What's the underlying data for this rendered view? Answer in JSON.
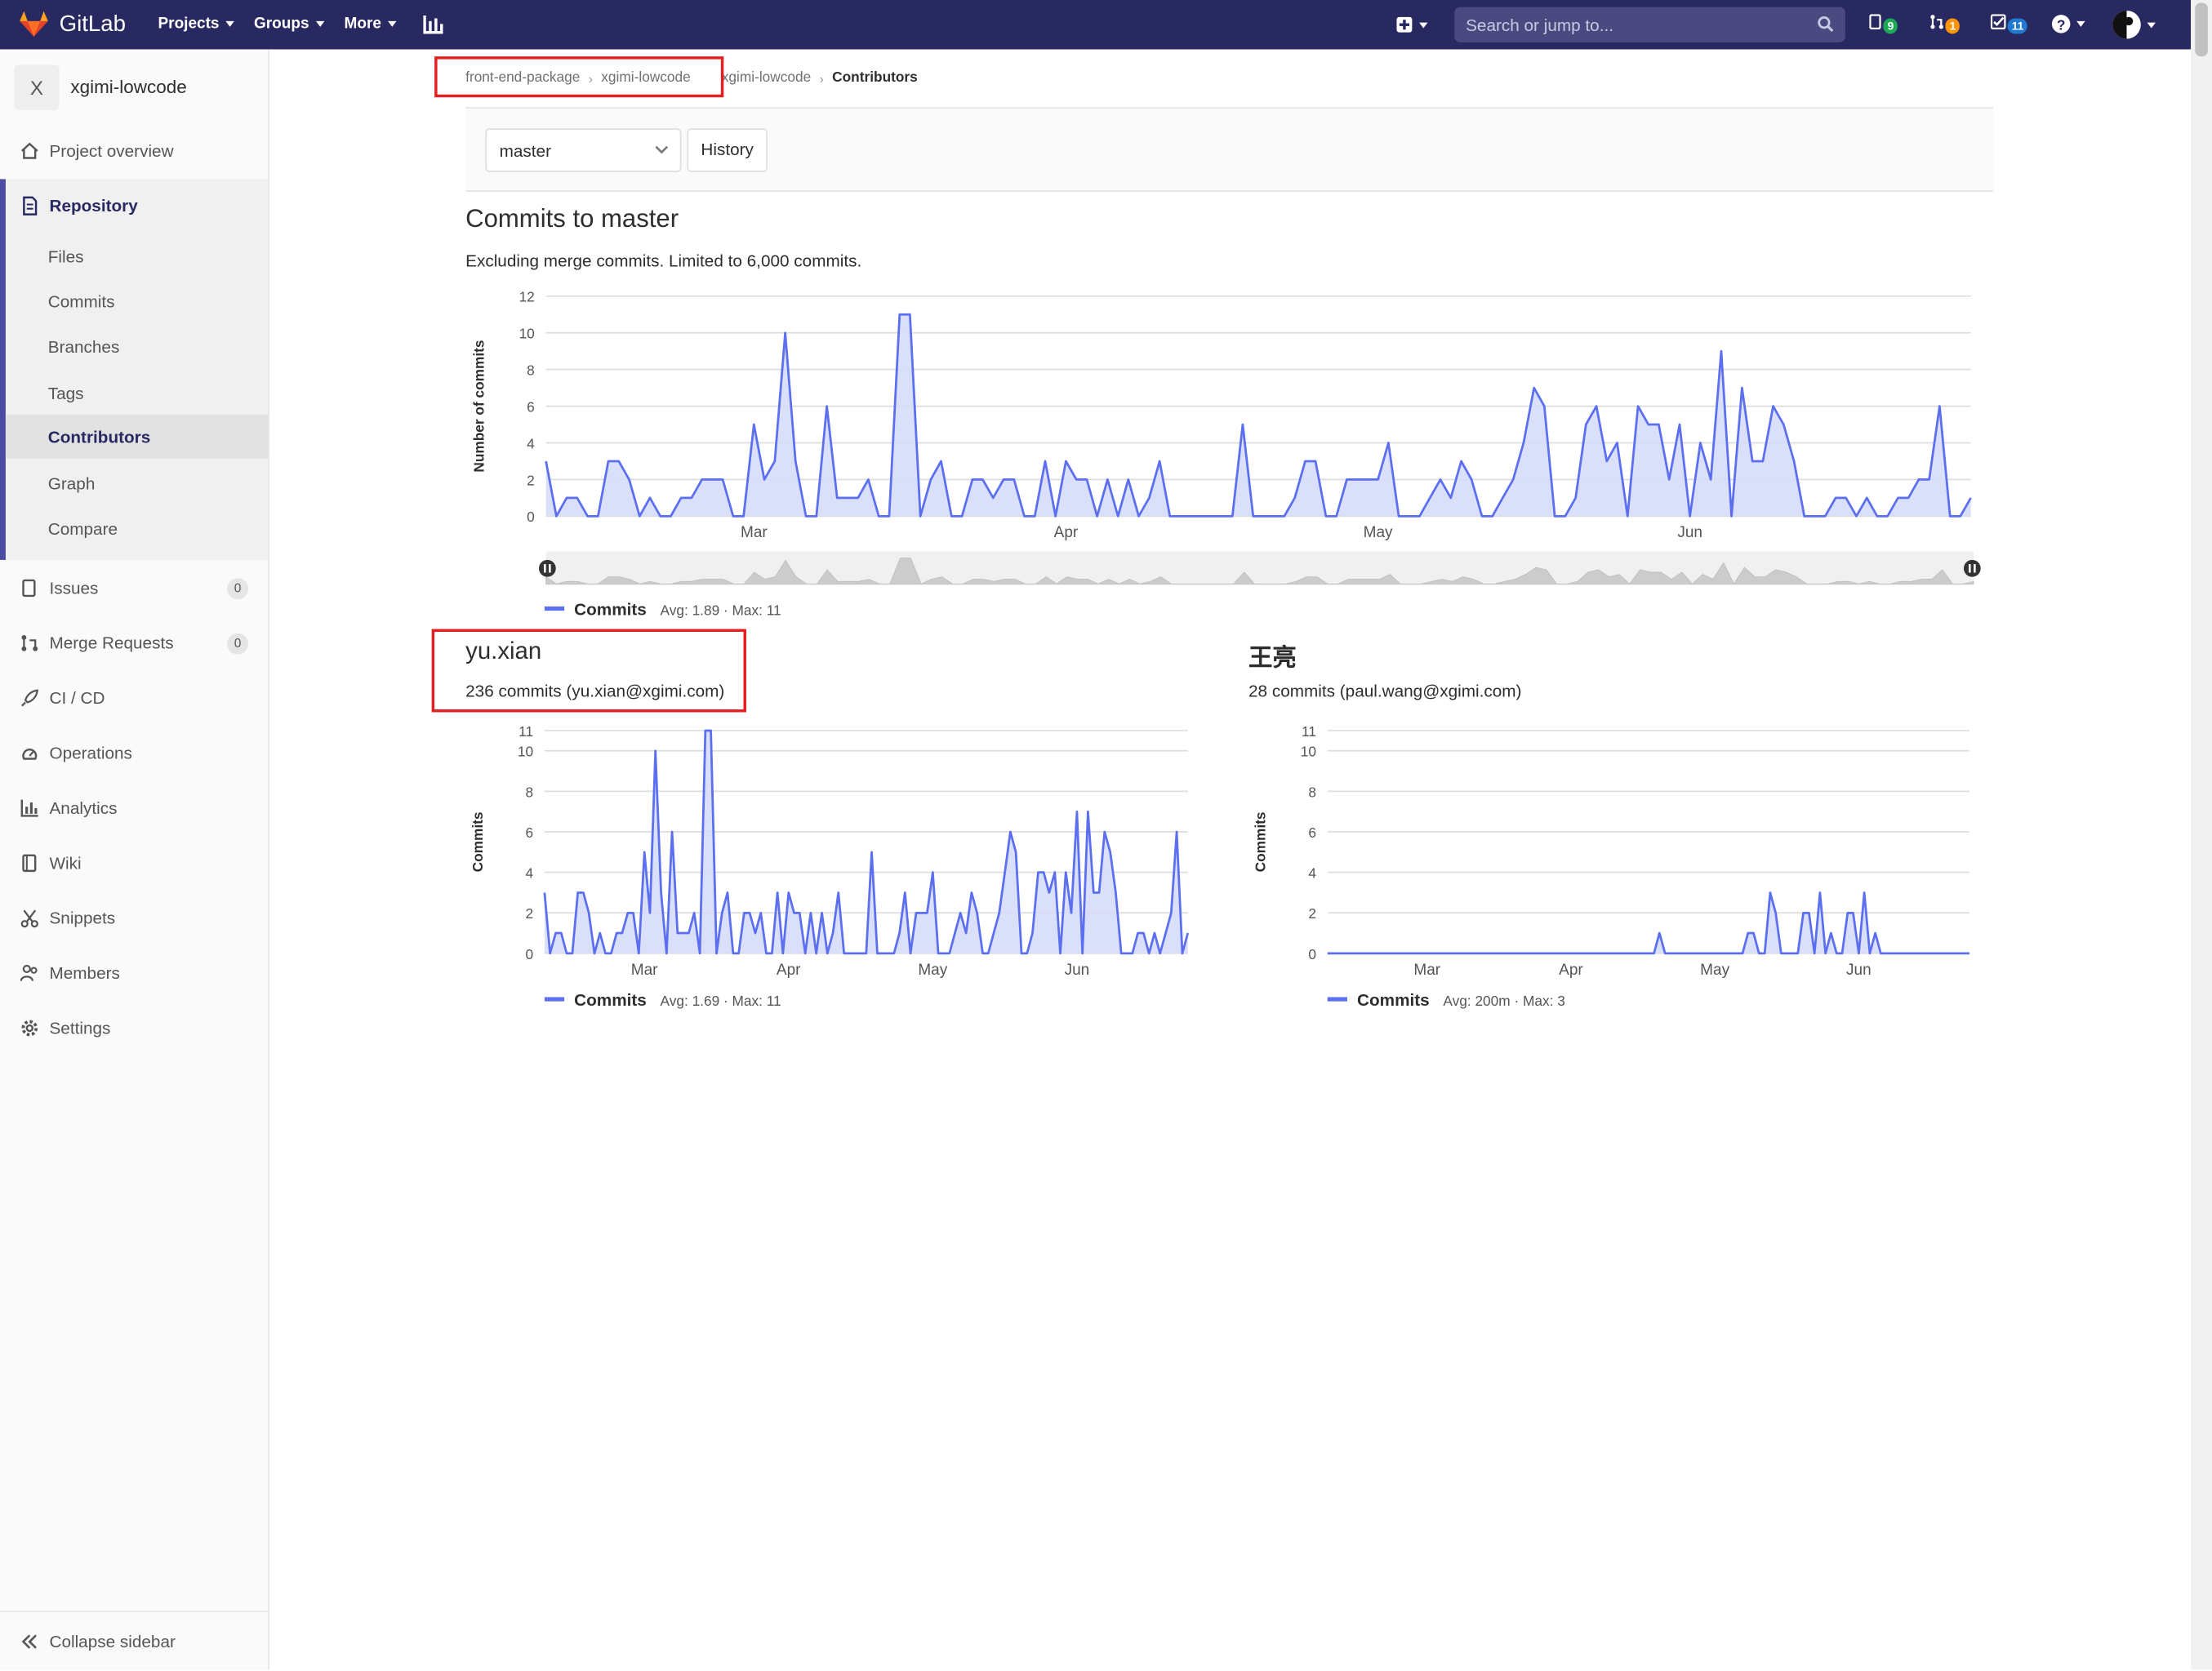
{
  "topbar": {
    "brand": "GitLab",
    "nav": [
      "Projects",
      "Groups",
      "More"
    ],
    "search_placeholder": "Search or jump to...",
    "counters": {
      "issues": "9",
      "merge_requests": "1",
      "todos": "11"
    },
    "colors": {
      "bg": "#292961",
      "issues_badge": "#1aaa55",
      "mr_badge": "#fc9403",
      "todo_badge": "#1f78d1"
    }
  },
  "sidebar": {
    "project_initial": "X",
    "project_name": "xgimi-lowcode",
    "overview": "Project overview",
    "repository": "Repository",
    "repo_items": [
      "Files",
      "Commits",
      "Branches",
      "Tags",
      "Contributors",
      "Graph",
      "Compare"
    ],
    "issues": {
      "label": "Issues",
      "count": "0"
    },
    "merge_requests": {
      "label": "Merge Requests",
      "count": "0"
    },
    "ci_cd": "CI / CD",
    "operations": "Operations",
    "analytics": "Analytics",
    "wiki": "Wiki",
    "snippets": "Snippets",
    "members": "Members",
    "settings": "Settings",
    "collapse": "Collapse sidebar"
  },
  "breadcrumb": [
    "front-end-package",
    "xgimi-lowcode",
    "xgimi-lowcode",
    "Contributors"
  ],
  "branch": {
    "selected": "master",
    "history_label": "History"
  },
  "main": {
    "title": "Commits to master",
    "subtitle": "Excluding merge commits. Limited to 6,000 commits."
  },
  "contributors": [
    {
      "name": "yu.xian",
      "commits_text": "236 commits (yu.xian@xgimi.com)"
    },
    {
      "name": "王亮",
      "commits_text": "28 commits (paul.wang@xgimi.com)"
    }
  ],
  "chart_data": [
    {
      "type": "area",
      "ylabel": "Number of commits",
      "ylim": [
        0,
        12
      ],
      "y_ticks": [
        0,
        2,
        4,
        6,
        8,
        10,
        12
      ],
      "x_tick_labels": [
        "Mar",
        "Apr",
        "May",
        "Jun"
      ],
      "x_tick_index": [
        20,
        50,
        80,
        110
      ],
      "legend": {
        "label": "Commits",
        "stats": "Avg: 1.89 · Max: 11"
      },
      "color": "#5b6ff0",
      "values": [
        3,
        0,
        1,
        1,
        0,
        0,
        3,
        3,
        2,
        0,
        1,
        0,
        0,
        1,
        1,
        2,
        2,
        2,
        0,
        0,
        5,
        2,
        3,
        10,
        3,
        0,
        0,
        6,
        1,
        1,
        1,
        2,
        0,
        0,
        11,
        11,
        0,
        2,
        3,
        0,
        0,
        2,
        2,
        1,
        2,
        2,
        0,
        0,
        3,
        0,
        3,
        2,
        2,
        0,
        2,
        0,
        2,
        0,
        1,
        3,
        0,
        0,
        0,
        0,
        0,
        0,
        0,
        5,
        0,
        0,
        0,
        0,
        1,
        3,
        3,
        0,
        0,
        2,
        2,
        2,
        2,
        4,
        0,
        0,
        0,
        1,
        2,
        1,
        3,
        2,
        0,
        0,
        1,
        2,
        4,
        7,
        6,
        0,
        0,
        1,
        5,
        6,
        3,
        4,
        0,
        6,
        5,
        5,
        2,
        5,
        0,
        4,
        2,
        9,
        0,
        7,
        3,
        3,
        6,
        5,
        3,
        0,
        0,
        0,
        1,
        1,
        0,
        1,
        0,
        0,
        1,
        1,
        2,
        2,
        6,
        0,
        0,
        1
      ]
    },
    {
      "type": "area",
      "ylabel": "Commits",
      "ylim": [
        0,
        11
      ],
      "y_ticks": [
        0,
        2,
        4,
        6,
        8,
        10,
        11
      ],
      "x_tick_labels": [
        "Mar",
        "Apr",
        "May",
        "Jun"
      ],
      "x_tick_index": [
        18,
        44,
        70,
        96
      ],
      "legend": {
        "label": "Commits",
        "stats": "Avg: 1.69 · Max: 11"
      },
      "color": "#5b6ff0",
      "values": [
        3,
        0,
        1,
        1,
        0,
        0,
        3,
        3,
        2,
        0,
        1,
        0,
        0,
        1,
        1,
        2,
        2,
        0,
        5,
        2,
        10,
        3,
        0,
        6,
        1,
        1,
        1,
        2,
        0,
        11,
        11,
        0,
        2,
        3,
        0,
        0,
        2,
        2,
        1,
        2,
        0,
        0,
        3,
        0,
        3,
        2,
        2,
        0,
        2,
        0,
        2,
        0,
        1,
        3,
        0,
        0,
        0,
        0,
        0,
        5,
        0,
        0,
        0,
        0,
        1,
        3,
        0,
        2,
        2,
        2,
        4,
        0,
        0,
        0,
        1,
        2,
        1,
        3,
        2,
        0,
        0,
        1,
        2,
        4,
        6,
        5,
        0,
        0,
        1,
        4,
        4,
        3,
        4,
        0,
        4,
        2,
        7,
        0,
        7,
        3,
        3,
        6,
        5,
        3,
        0,
        0,
        0,
        1,
        1,
        0,
        1,
        0,
        1,
        2,
        6,
        0,
        1
      ]
    },
    {
      "type": "area",
      "ylabel": "Commits",
      "ylim": [
        0,
        11
      ],
      "y_ticks": [
        0,
        2,
        4,
        6,
        8,
        10,
        11
      ],
      "x_tick_labels": [
        "Mar",
        "Apr",
        "May",
        "Jun"
      ],
      "x_tick_index": [
        18,
        44,
        70,
        96
      ],
      "legend": {
        "label": "Commits",
        "stats": "Avg: 200m · Max: 3"
      },
      "color": "#5b6ff0",
      "values": [
        0,
        0,
        0,
        0,
        0,
        0,
        0,
        0,
        0,
        0,
        0,
        0,
        0,
        0,
        0,
        0,
        0,
        0,
        0,
        0,
        0,
        0,
        0,
        0,
        0,
        0,
        0,
        0,
        0,
        0,
        0,
        0,
        0,
        0,
        0,
        0,
        0,
        0,
        0,
        0,
        0,
        0,
        0,
        0,
        0,
        0,
        0,
        0,
        0,
        0,
        0,
        0,
        0,
        0,
        0,
        0,
        0,
        0,
        0,
        0,
        1,
        0,
        0,
        0,
        0,
        0,
        0,
        0,
        0,
        0,
        0,
        0,
        0,
        0,
        0,
        0,
        1,
        1,
        0,
        0,
        3,
        2,
        0,
        0,
        0,
        0,
        2,
        2,
        0,
        3,
        0,
        1,
        0,
        0,
        2,
        2,
        0,
        3,
        0,
        1,
        0,
        0,
        0,
        0,
        0,
        0,
        0,
        0,
        0,
        0,
        0,
        0,
        0,
        0,
        0,
        0,
        0
      ]
    }
  ]
}
